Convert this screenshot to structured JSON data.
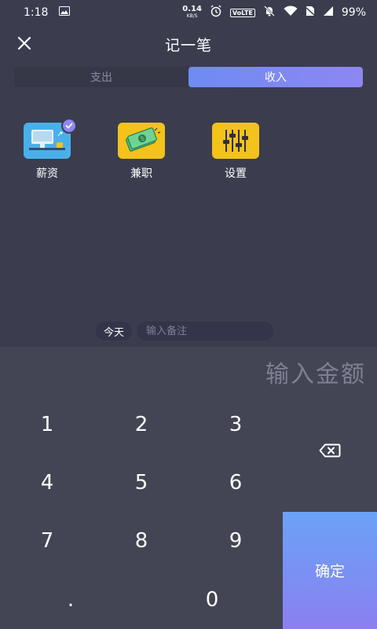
{
  "status_bar": {
    "time": "1:18",
    "net_speed": "0.14",
    "net_unit": "KB/S",
    "volte": "VoLTE",
    "battery": "99%"
  },
  "header": {
    "title": "记一笔"
  },
  "tabs": [
    {
      "label": "支出",
      "active": false
    },
    {
      "label": "收入",
      "active": true
    }
  ],
  "categories": [
    {
      "label": "薪资",
      "icon": "salary-icon",
      "selected": true
    },
    {
      "label": "兼职",
      "icon": "money-icon",
      "selected": false
    },
    {
      "label": "设置",
      "icon": "sliders-icon",
      "selected": false
    }
  ],
  "note": {
    "date_label": "今天",
    "placeholder": "输入备注"
  },
  "amount": {
    "placeholder": "输入金额"
  },
  "keypad": {
    "keys": [
      "1",
      "2",
      "3",
      "4",
      "5",
      "6",
      "7",
      "8",
      "9",
      ".",
      "0"
    ],
    "confirm_label": "确定"
  },
  "colors": {
    "background": "#3b3c4d",
    "keypad_background": "#434454",
    "accent_start": "#6d8cf3",
    "accent_end": "#8f86f2",
    "salary_tile": "#4ab0ea",
    "yellow_tile": "#f3c21b"
  }
}
